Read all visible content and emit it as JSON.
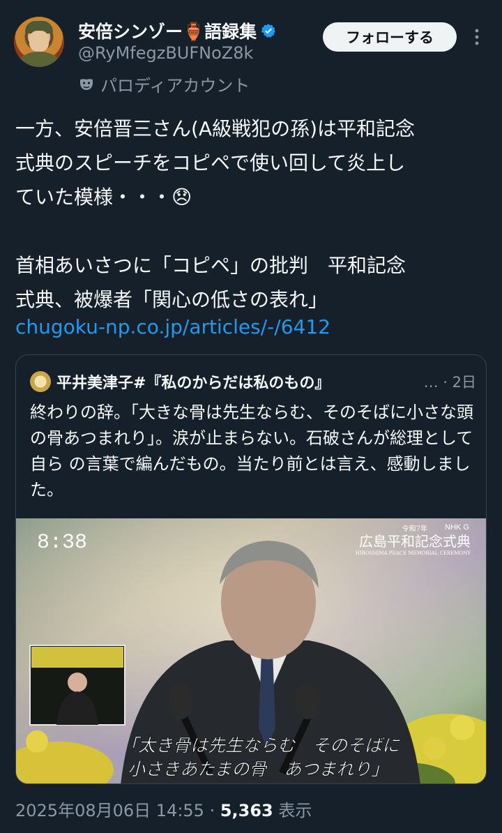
{
  "author": {
    "display_name": "安倍シンゾー🏺語録集",
    "handle": "@RyMfegzBUFNoZ8k",
    "label": "パロディアカウント",
    "verified_icon": "verified-badge-icon",
    "label_icon": "mask-icon"
  },
  "actions": {
    "follow_label": "フォローする",
    "more_icon": "more-options-icon"
  },
  "post": {
    "text": "一方、安倍晋三さん(A級戦犯の孫)は平和記念\n式典のスピーチをコピペで使い回して炎上し\nていた模様・・・😞\n\n首相あいさつに「コピペ」の批判　平和記念\n式典、被爆者「関心の低さの表れ」",
    "link": "chugoku-np.co.jp/articles/-/6412"
  },
  "quote": {
    "author_name": "平井美津子#『私のからだは私のもの』",
    "meta": "… · 2日",
    "text": "終わりの辞。「大きな骨は先生ならむ、そのそばに小さな頭の骨あつまれり」。涙が止まらない。石破さんが総理として自ら の言葉で編んだもの。当たり前とは言え、感動しました。",
    "media": {
      "clock": "8:38",
      "broadcaster": "NHK G",
      "era": "令和7年",
      "ceremony_title": "広島平和記念式典",
      "ceremony_subtitle": "HIROSHIMA PEACE MEMORIAL CEREMONY",
      "caption_line1": "「太き骨は先生ならむ　そのそばに",
      "caption_line2": "小さきあたまの骨　あつまれり」"
    }
  },
  "footer": {
    "timestamp": "2025年08月06日 14:55",
    "separator": " · ",
    "views": "5,363",
    "views_label": " 表示"
  }
}
